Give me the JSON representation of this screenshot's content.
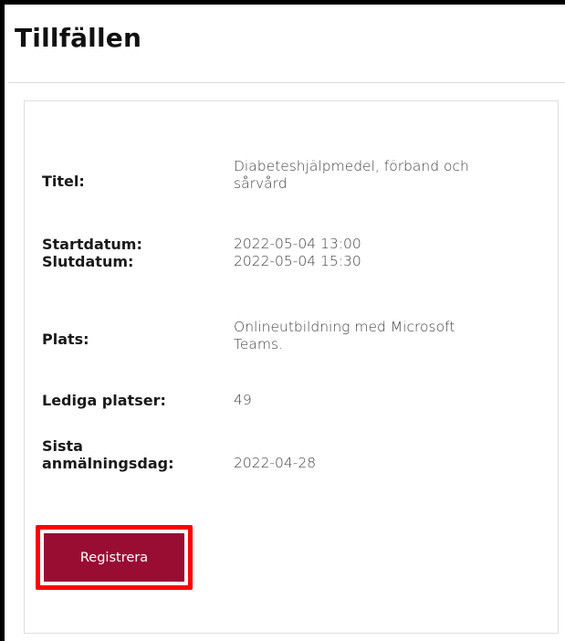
{
  "page": {
    "title": "Tillfällen"
  },
  "details": {
    "title_label": "Titel:",
    "title_value_line1": "Diabeteshjälpmedel, förband och",
    "title_value_line2": "sårvård",
    "start_label": "Startdatum:",
    "start_value": "2022-05-04 13:00",
    "end_label": "Slutdatum:",
    "end_value": "2022-05-04 15:30",
    "location_label": "Plats:",
    "location_value_line1": "Onlineutbildning med Microsoft",
    "location_value_line2": "Teams.",
    "seats_label": "Lediga platser:",
    "seats_value": "49",
    "deadline_label_line1": "Sista",
    "deadline_label_line2": "anmälningsdag:",
    "deadline_value": "2022-04-28"
  },
  "actions": {
    "register_label": "Registrera",
    "register_color": "#990d33",
    "highlight_color": "#ff0000"
  }
}
